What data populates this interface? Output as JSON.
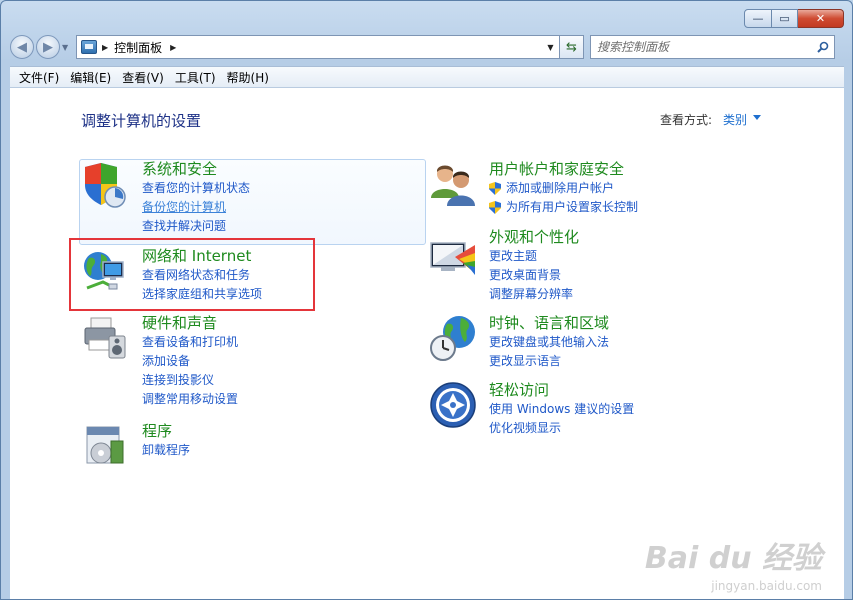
{
  "window": {
    "minimize": "—",
    "maximize": "▭",
    "close": "✕"
  },
  "nav": {
    "back": "◀",
    "forward": "▶",
    "address": "控制面板",
    "search_placeholder": "搜索控制面板"
  },
  "menu": [
    "文件(F)",
    "编辑(E)",
    "查看(V)",
    "工具(T)",
    "帮助(H)"
  ],
  "page": {
    "title": "调整计算机的设置",
    "view_by_label": "查看方式:",
    "view_by_value": "类别"
  },
  "categories": {
    "system": {
      "title": "系统和安全",
      "links": [
        "查看您的计算机状态",
        "备份您的计算机",
        "查找并解决问题"
      ]
    },
    "network": {
      "title": "网络和 Internet",
      "links": [
        "查看网络状态和任务",
        "选择家庭组和共享选项"
      ]
    },
    "hardware": {
      "title": "硬件和声音",
      "links": [
        "查看设备和打印机",
        "添加设备",
        "连接到投影仪",
        "调整常用移动设置"
      ]
    },
    "programs": {
      "title": "程序",
      "links": [
        "卸载程序"
      ]
    },
    "users": {
      "title": "用户帐户和家庭安全",
      "links": [
        "添加或删除用户帐户",
        "为所有用户设置家长控制"
      ]
    },
    "appearance": {
      "title": "外观和个性化",
      "links": [
        "更改主题",
        "更改桌面背景",
        "调整屏幕分辨率"
      ]
    },
    "clock": {
      "title": "时钟、语言和区域",
      "links": [
        "更改键盘或其他输入法",
        "更改显示语言"
      ]
    },
    "ease": {
      "title": "轻松访问",
      "links": [
        "使用 Windows 建议的设置",
        "优化视频显示"
      ]
    }
  },
  "watermark": {
    "brand": "Bai du 经验",
    "url": "jingyan.baidu.com"
  },
  "colors": {
    "link": "#1f58c8",
    "category_title": "#1e8a1e",
    "page_title": "#1e3287",
    "highlight": "#e4353a"
  }
}
